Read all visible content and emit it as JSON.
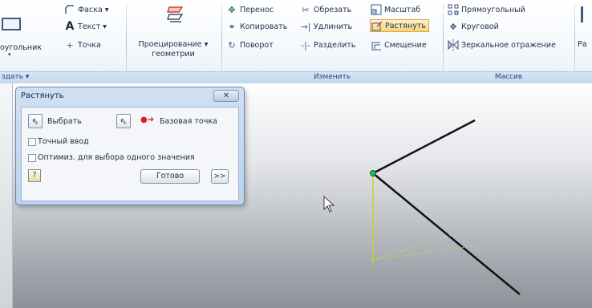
{
  "ribbon": {
    "panel_create_partial": {
      "big_button_label": "оугольник",
      "title": "здать ▾"
    },
    "fillet_group": {
      "chamfer": "Фаска ▾",
      "text": "Текст ▾",
      "point": "Точка"
    },
    "project_geometry": {
      "line1": "Проецирование ▾",
      "line2": "геометрии"
    },
    "modify_panel": {
      "title": "Изменить",
      "move": "Перенос",
      "copy": "Копировать",
      "rotate": "Поворот",
      "trim": "Обрезать",
      "extend": "Удлинить",
      "split": "Разделить",
      "scale": "Масштаб",
      "stretch": "Растянуть",
      "offset": "Смещение"
    },
    "pattern_panel": {
      "title": "Массив",
      "rectangular": "Прямоугольный",
      "circular": "Круговой",
      "mirror": "Зеркальное отражение"
    },
    "right_cut": {
      "label": "Ра"
    }
  },
  "dialog": {
    "title": "Растянуть",
    "close_label": "✕",
    "select_label": "Выбрать",
    "base_point_label": "Базовая точка",
    "precise_input_label": "Точный ввод",
    "optimize_label": "Оптимиз. для выбора одного значения",
    "help_label": "?",
    "done_label": "Готово",
    "more_label": ">>"
  },
  "colors": {
    "geometry_line": "#111111",
    "highlight_line": "#c8d424",
    "base_point": "#2db84a",
    "base_point_marker": "#d62020",
    "stretch_active_bg": "#f8d37c"
  }
}
